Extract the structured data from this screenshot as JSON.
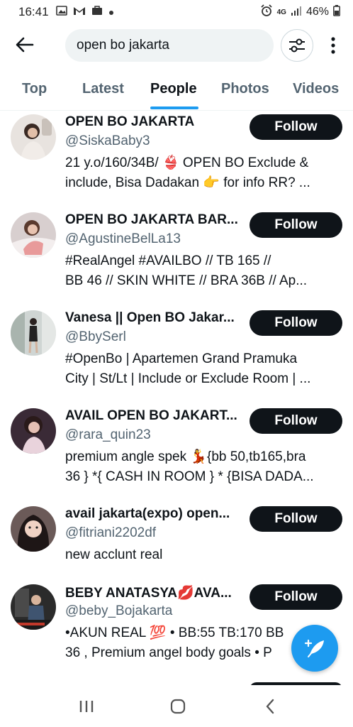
{
  "status_bar": {
    "time": "16:41",
    "network": "4G",
    "battery": "46%",
    "icons": [
      "image-icon",
      "gmail-icon",
      "bag-icon",
      "dot-icon",
      "alarm-icon",
      "signal-icon",
      "battery-icon"
    ]
  },
  "search": {
    "query": "open bo jakarta"
  },
  "tabs": [
    {
      "label": "Top",
      "active": false
    },
    {
      "label": "Latest",
      "active": false
    },
    {
      "label": "People",
      "active": true
    },
    {
      "label": "Photos",
      "active": false
    },
    {
      "label": "Videos",
      "active": false
    }
  ],
  "follow_label": "Follow",
  "people": [
    {
      "name": "OPEN BO JAKARTA",
      "handle": "@SiskaBaby3",
      "bio": [
        "21 y.o/160/34B/ 👙 OPEN BO Exclude &",
        "include, Bisa Dadakan 👉 for info RR? ..."
      ]
    },
    {
      "name": "OPEN BO JAKARTA BAR...",
      "handle": "@AgustineBelLa13",
      "bio": [
        "#RealAngel #AVAILBO // TB 165 //",
        "BB 46 // SKIN WHITE // BRA 36B // Ap..."
      ]
    },
    {
      "name": "Vanesa || Open BO Jakar...",
      "handle": "@BbySerl",
      "bio": [
        "#OpenBo | Apartemen Grand Pramuka",
        "City | St/Lt | Include or Exclude Room | ..."
      ]
    },
    {
      "name": "AVAIL OPEN BO JAKART...",
      "handle": "@rara_quin23",
      "bio": [
        "premium angle spek 💃{bb 50,tb165,bra",
        "36 } *{ CASH IN ROOM } * {BISA DADA..."
      ]
    },
    {
      "name": "avail jakarta(expo) open...",
      "handle": "@fitriani2202df",
      "bio": [
        "new acclunt real"
      ]
    },
    {
      "name": "BEBY ANATASYA💋AVA...",
      "handle": "@beby_Bojakarta",
      "bio": [
        "•AKUN REAL 💯 • BB:55 TB:170 BB",
        "36 , Premium angel body goals • P"
      ]
    }
  ],
  "colors": {
    "accent": "#1d9bf0",
    "text_primary": "#0f1419",
    "text_secondary": "#536471",
    "follow_bg": "#0f1419",
    "search_bg": "#eff3f4"
  },
  "nav": {
    "icons": [
      "recents-icon",
      "home-icon",
      "back-icon"
    ]
  }
}
